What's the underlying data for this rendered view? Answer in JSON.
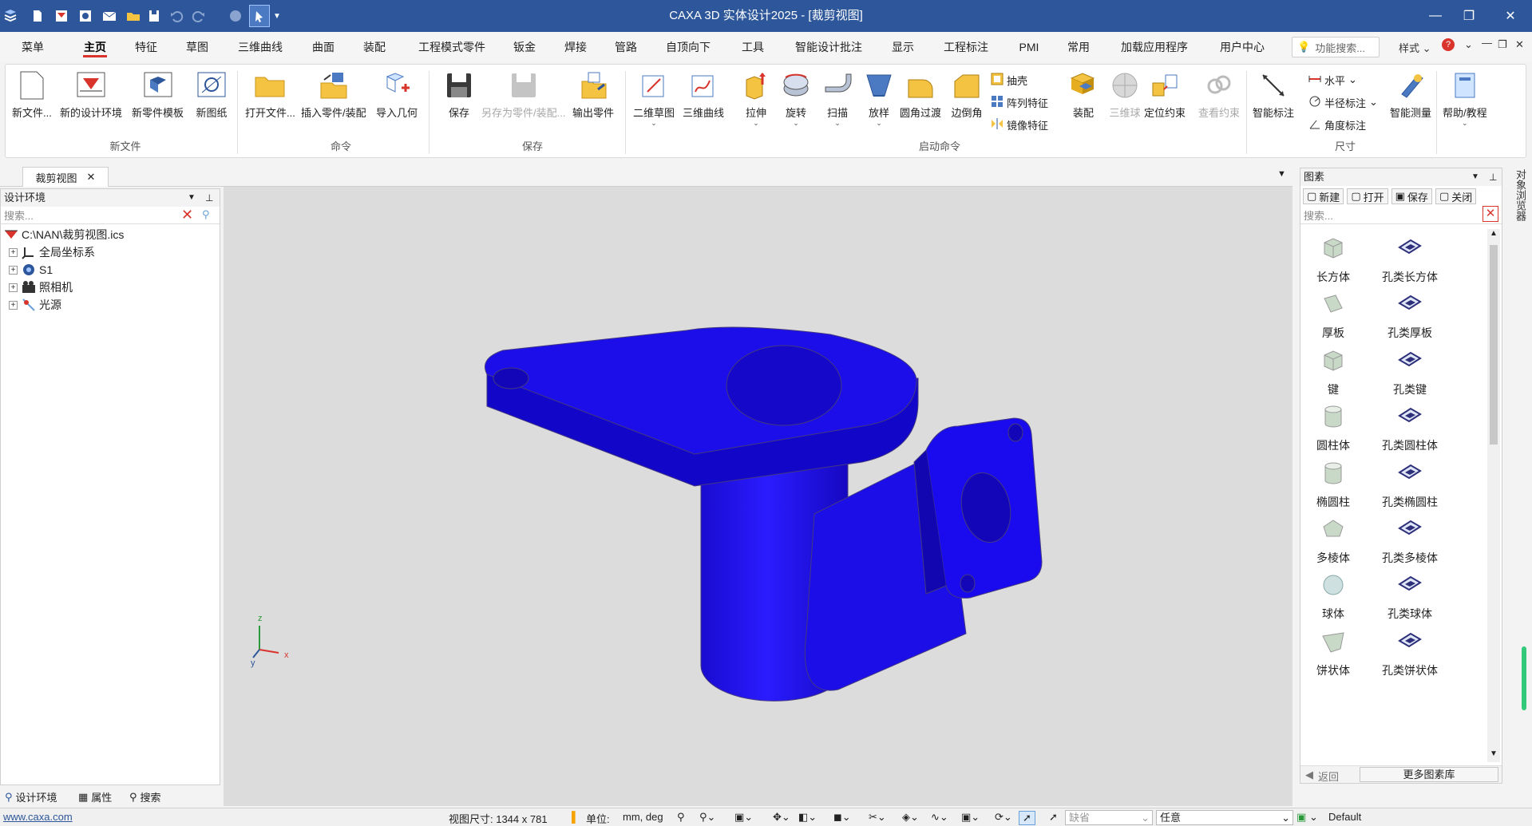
{
  "window": {
    "title": "CAXA 3D 实体设计2025 - [裁剪视图]",
    "controls": {
      "minimize": "—",
      "maximize": "❐",
      "close": "✕"
    }
  },
  "menu": {
    "tabs": [
      "菜单",
      "主页",
      "特征",
      "草图",
      "三维曲线",
      "曲面",
      "装配",
      "工程模式零件",
      "钣金",
      "焊接",
      "管路",
      "自顶向下",
      "工具",
      "智能设计批注",
      "显示",
      "工程标注",
      "PMI",
      "常用",
      "加载应用程序",
      "用户中心"
    ],
    "active": "主页",
    "search_placeholder": "功能搜索...",
    "style_label": "样式"
  },
  "ribbon": {
    "new_file": "新文件...",
    "new_design_env": "新的设计环境",
    "new_part_template": "新零件模板",
    "new_drawing": "新图纸",
    "group_new": "新文件",
    "open_file": "打开文件...",
    "insert_part": "插入零件/装配",
    "import_geometry": "导入几何",
    "group_command": "命令",
    "save": "保存",
    "save_as_part": "另存为零件/装配...",
    "export_part": "输出零件",
    "group_save": "保存",
    "sketch_2d": "二维草图",
    "curve_3d": "三维曲线",
    "extrude": "拉伸",
    "revolve": "旋转",
    "sweep": "扫描",
    "loft": "放样",
    "fillet": "圆角过渡",
    "chamfer": "边倒角",
    "shell": "抽壳",
    "pattern": "阵列特征",
    "mirror": "镜像特征",
    "assembly": "装配",
    "sphere_3d": "三维球",
    "position_constraint": "定位约束",
    "view_constraint": "查看约束",
    "group_launch": "启动命令",
    "smart_dimension": "智能标注",
    "horizontal": "水平",
    "radius_dimension": "半径标注",
    "angle_dimension": "角度标注",
    "smart_measure": "智能测量",
    "group_dimension": "尺寸",
    "help_tutorial": "帮助/教程"
  },
  "document": {
    "tab_label": "裁剪视图"
  },
  "left_panel": {
    "title": "设计环境",
    "search_placeholder": "搜索...",
    "tree": [
      {
        "label": "C:\\NAN\\裁剪视图.ics",
        "icon": "design-env-icon"
      },
      {
        "label": "全局坐标系",
        "icon": "coordinate-system-icon"
      },
      {
        "label": "S1",
        "icon": "scene-icon"
      },
      {
        "label": "照相机",
        "icon": "camera-icon"
      },
      {
        "label": "光源",
        "icon": "light-icon"
      }
    ],
    "bottom_tabs": [
      "设计环境",
      "属性",
      "搜索"
    ]
  },
  "viewport": {
    "axis_labels": {
      "x": "x",
      "y": "y",
      "z": "z"
    },
    "part_color": "#1a0be0"
  },
  "right_panel": {
    "title": "图素",
    "toolbar": [
      "新建",
      "打开",
      "保存",
      "关闭"
    ],
    "search_placeholder": "搜索...",
    "items": [
      {
        "label": "长方体",
        "icon": "box-icon"
      },
      {
        "label": "孔类长方体",
        "icon": "hole-box-icon"
      },
      {
        "label": "厚板",
        "icon": "slab-icon"
      },
      {
        "label": "孔类厚板",
        "icon": "hole-slab-icon"
      },
      {
        "label": "键",
        "icon": "key-icon"
      },
      {
        "label": "孔类键",
        "icon": "hole-key-icon"
      },
      {
        "label": "圆柱体",
        "icon": "cylinder-icon"
      },
      {
        "label": "孔类圆柱体",
        "icon": "hole-cylinder-icon"
      },
      {
        "label": "椭圆柱",
        "icon": "ellipse-cylinder-icon"
      },
      {
        "label": "孔类椭圆柱",
        "icon": "hole-ellipse-cylinder-icon"
      },
      {
        "label": "多棱体",
        "icon": "prism-icon"
      },
      {
        "label": "孔类多棱体",
        "icon": "hole-prism-icon"
      },
      {
        "label": "球体",
        "icon": "sphere-icon"
      },
      {
        "label": "孔类球体",
        "icon": "hole-sphere-icon"
      },
      {
        "label": "饼状体",
        "icon": "pie-icon"
      },
      {
        "label": "孔类饼状体",
        "icon": "hole-pie-icon"
      }
    ],
    "back_label": "返回",
    "more_label": "更多图素库",
    "side_label": "对象浏览器"
  },
  "status": {
    "url": "www.caxa.com",
    "view_size_label": "视图尺寸: 1344 x  781",
    "unit_label": "单位:",
    "unit_value": "mm, deg",
    "combo_default": "缺省",
    "any_label": "任意",
    "default_value": "Default"
  }
}
